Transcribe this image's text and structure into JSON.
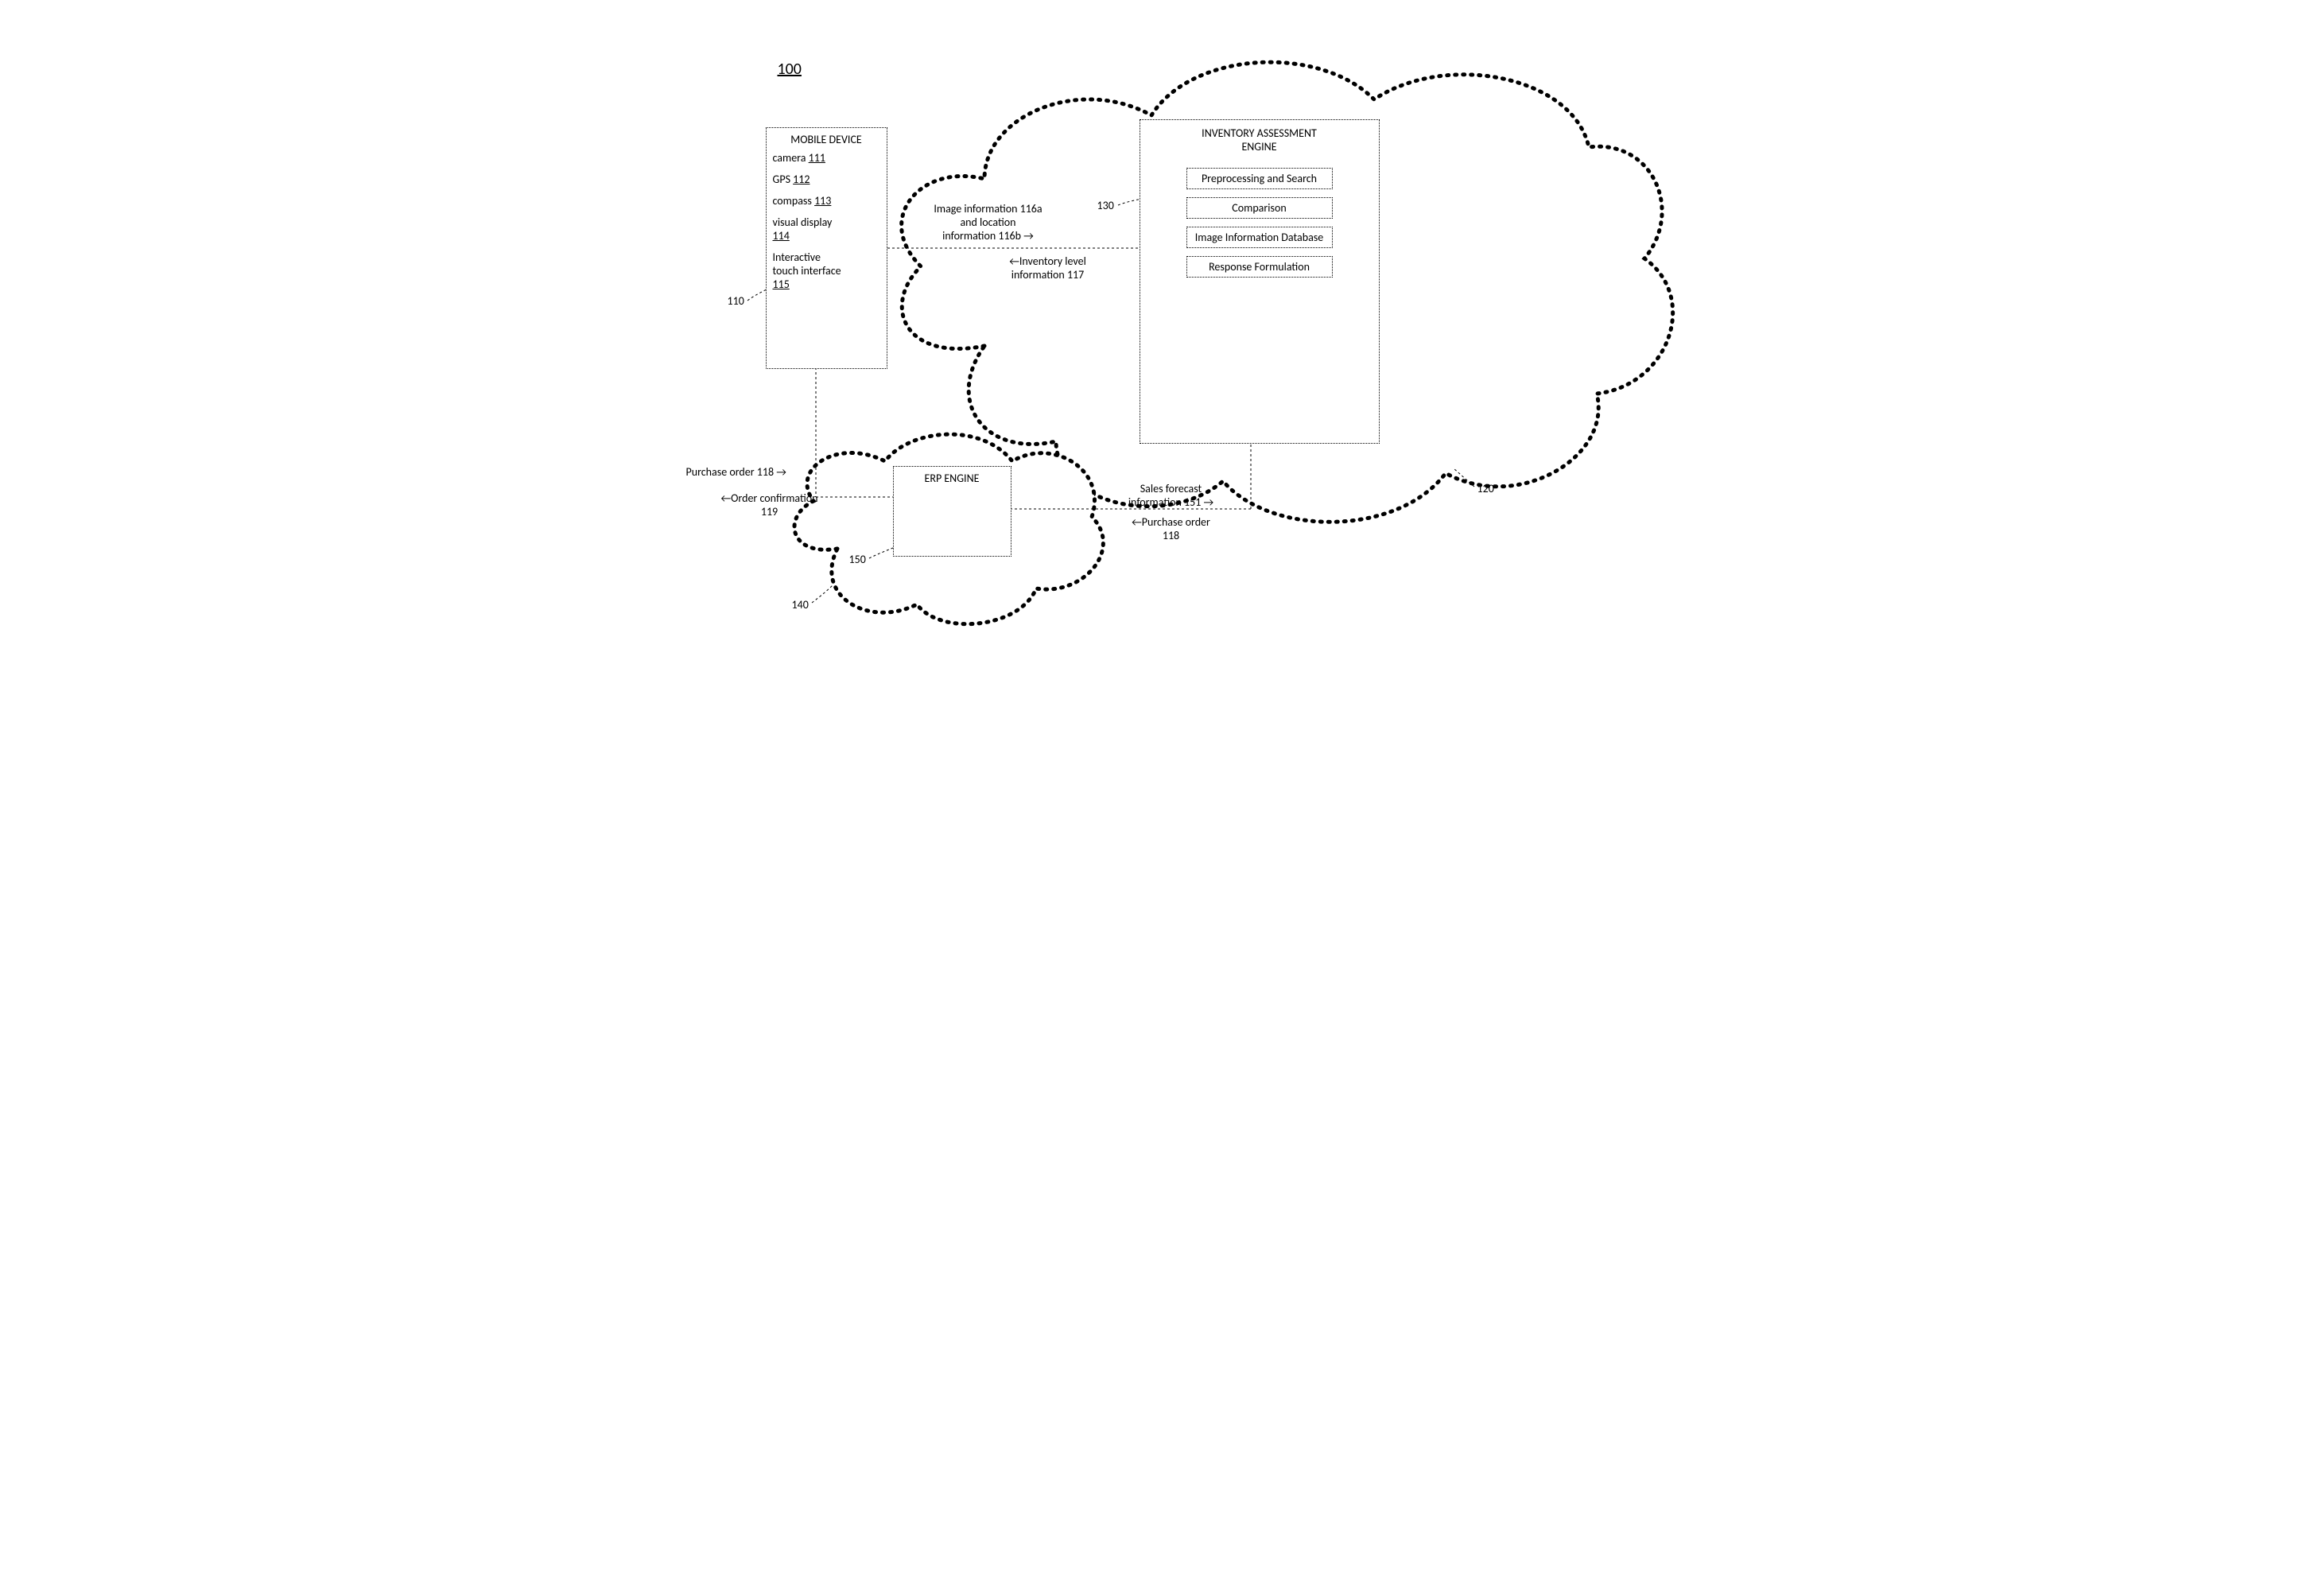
{
  "figure_ref": "100",
  "mobile_device": {
    "title": "MOBILE DEVICE",
    "camera_label": "camera ",
    "camera_ref": "111",
    "gps_label": "GPS ",
    "gps_ref": "112",
    "compass_label": "compass ",
    "compass_ref": "113",
    "display_label": "visual display",
    "display_ref": "114",
    "touch_label1": "Interactive",
    "touch_label2": "touch interface",
    "touch_ref": "115",
    "box_ref": "110"
  },
  "engine": {
    "title1": "INVENTORY ASSESSMENT",
    "title2": "ENGINE",
    "sub1": "Preprocessing and Search",
    "sub2": "Comparison",
    "sub3": "Image Information Database",
    "sub4": "Response Formulation",
    "box_ref": "130",
    "cloud_ref": "120"
  },
  "erp": {
    "title": "ERP ENGINE",
    "box_ref": "150",
    "cloud_ref": "140"
  },
  "flows": {
    "img_line1": "Image information 116a",
    "img_line2": "and location",
    "img_line3": "information 116b",
    "inv_line1": "Inventory level",
    "inv_line2": "information 117",
    "po_label": "Purchase order 118",
    "conf_line1": "Order confirmation",
    "conf_line2": "119",
    "salesf_line1": "Sales forecast",
    "salesf_line2": "information 151",
    "po2_line1": "Purchase order",
    "po2_line2": "118"
  }
}
